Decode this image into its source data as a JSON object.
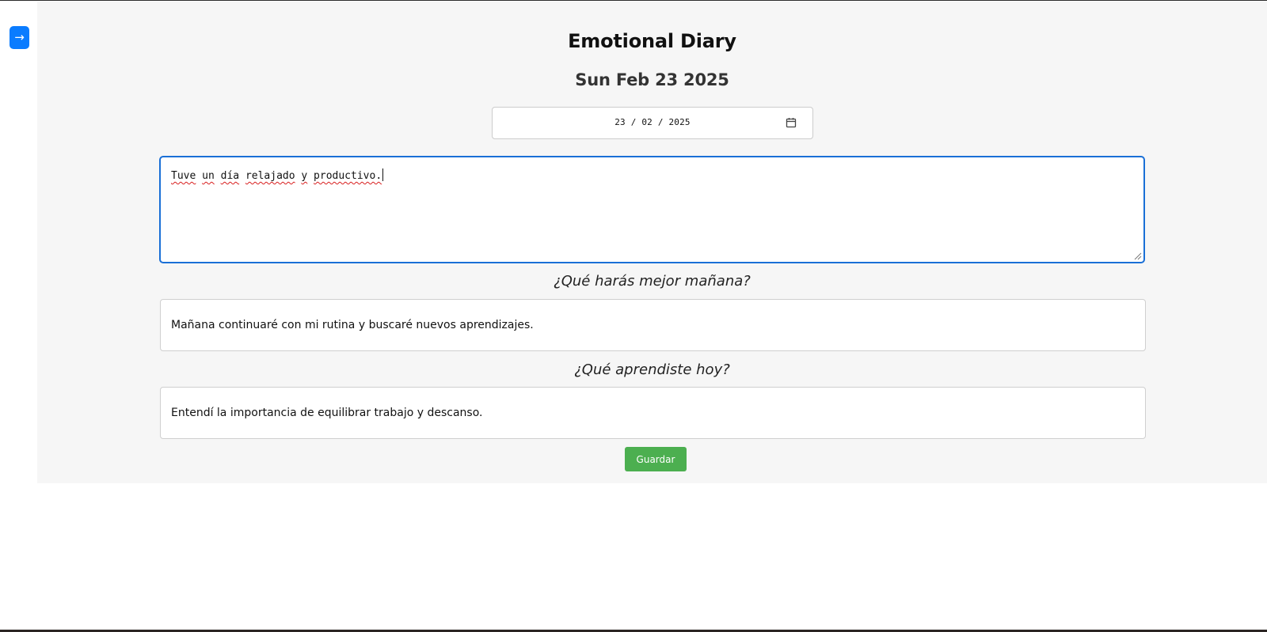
{
  "sidebar": {
    "toggle_label": "→"
  },
  "header": {
    "title": "Emotional Diary",
    "date_heading": "Sun Feb 23 2025"
  },
  "date_input": {
    "value": "23 / 02 / 2025"
  },
  "entry": {
    "text_words": [
      "Tuve",
      "un",
      "día",
      "relajado",
      "y",
      "productivo."
    ]
  },
  "questions": [
    {
      "label": "¿Qué harás mejor mañana?",
      "answer": "Mañana continuaré con mi rutina y buscaré nuevos aprendizajes."
    },
    {
      "label": "¿Qué aprendiste hoy?",
      "answer": "Entendí la importancia de equilibrar trabajo y descanso."
    }
  ],
  "actions": {
    "save_label": "Guardar"
  },
  "colors": {
    "toggle": "#0a7cff",
    "save": "#4caf50",
    "focus_border": "#1a6fd6",
    "panel_bg": "#f6f6f6"
  }
}
